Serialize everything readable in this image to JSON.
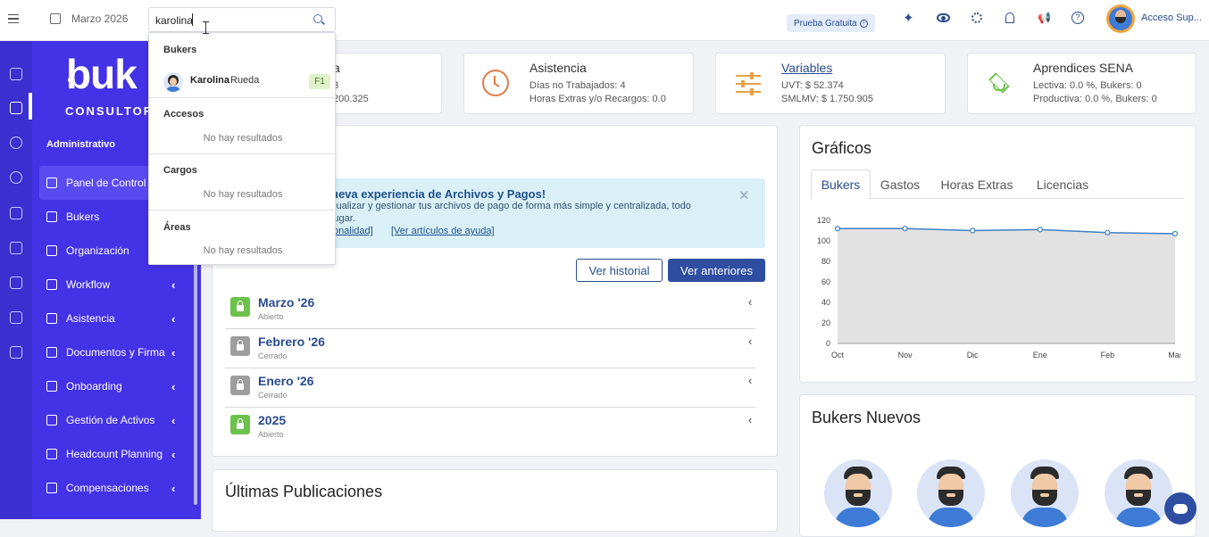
{
  "topbar": {
    "date_label": "Marzo 2026",
    "search_value": "karolina",
    "trial_badge": "Prueba Gratuita",
    "user_label": "Acceso Sup..."
  },
  "sidebar": {
    "brand_main": "buk",
    "brand_sub": "CONSULTOR",
    "section_label": "Administrativo",
    "items": [
      {
        "label": "Panel de Control",
        "icon": "dashboard-icon",
        "chevron": false,
        "active": true
      },
      {
        "label": "Bukers",
        "icon": "users-icon",
        "chevron": false
      },
      {
        "label": "Organización",
        "icon": "org-chart-icon",
        "chevron": false
      },
      {
        "label": "Workflow",
        "icon": "workflow-icon",
        "chevron": true
      },
      {
        "label": "Asistencia",
        "icon": "calendar-check-icon",
        "chevron": true
      },
      {
        "label": "Documentos y Firma",
        "icon": "documents-icon",
        "chevron": true
      },
      {
        "label": "Onboarding",
        "icon": "onboarding-icon",
        "chevron": true
      },
      {
        "label": "Gestión de Activos",
        "icon": "assets-icon",
        "chevron": true
      },
      {
        "label": "Headcount Planning",
        "icon": "headcount-icon",
        "chevron": true
      },
      {
        "label": "Compensaciones",
        "icon": "compensation-icon",
        "chevron": true
      }
    ]
  },
  "summary_cards": {
    "first": {
      "title_partial": "a",
      "line1_partial": "3",
      "line2_partial": "200.325"
    },
    "asistencia": {
      "title": "Asistencia",
      "line1": "Días no Trabajados: 4",
      "line2": "Horas Extras y/o Recargos: 0.0"
    },
    "variables": {
      "title": "Variables",
      "line1": "UVT: $ 52.374",
      "line2": "SMLMV: $ 1.750.905"
    },
    "sena": {
      "title": "Aprendices SENA",
      "line1": "Lectiva: 0.0 %, Bukers: 0",
      "line2": "Productiva: 0.0 %, Bukers: 0"
    }
  },
  "banner": {
    "title": "ueva experiencia de Archivos y Pagos!",
    "line1": "sualizar y gestionar tus archivos de pago de forma más simple y centralizada, todo",
    "line2": "lugar.",
    "link1": "ncionalidad]",
    "link2": "[Ver artículos de ayuda]"
  },
  "buttons": {
    "history": "Ver historial",
    "previous": "Ver anteriores"
  },
  "periods": [
    {
      "name": "Marzo '26",
      "status": "Abierto",
      "open": true
    },
    {
      "name": "Febrero '26",
      "status": "Cerrado",
      "open": false
    },
    {
      "name": "Enero '26",
      "status": "Cerrado",
      "open": false
    },
    {
      "name": "2025",
      "status": "Abierto",
      "open": true
    }
  ],
  "publications_title": "Últimas Publicaciones",
  "charts_card": {
    "title": "Gráficos",
    "tabs": [
      "Bukers",
      "Gastos",
      "Horas Extras",
      "Licencias"
    ],
    "active_tab": "Bukers"
  },
  "chart_data": {
    "type": "area",
    "categories": [
      "Oct",
      "Nov",
      "Dic",
      "Ene",
      "Feb",
      "Mar"
    ],
    "values": [
      112,
      112,
      110,
      111,
      108,
      107
    ],
    "ylim": [
      0,
      120
    ],
    "yticks": [
      "0",
      "20",
      "40",
      "60",
      "80",
      "100",
      "120"
    ],
    "title": "",
    "xlabel": "",
    "ylabel": "",
    "colors": {
      "line": "#3d7fc4",
      "fill": "#e2e2e2"
    }
  },
  "new_bukers": {
    "title": "Bukers Nuevos",
    "count": 4
  },
  "dropdown": {
    "sections": {
      "bukers": "Bukers",
      "accesos": "Accesos",
      "cargos": "Cargos",
      "areas": "Áreas"
    },
    "result": {
      "bold": "Karolina",
      "rest": " Rueda",
      "badge": "F1"
    },
    "no_results": "No hay resultados"
  },
  "colors": {
    "sidebar": "#4432e6",
    "rail": "#3b2fd0",
    "accent_blue": "#2a4b8d",
    "open_lock": "#6cc24a",
    "closed_lock": "#9e9e9e"
  }
}
